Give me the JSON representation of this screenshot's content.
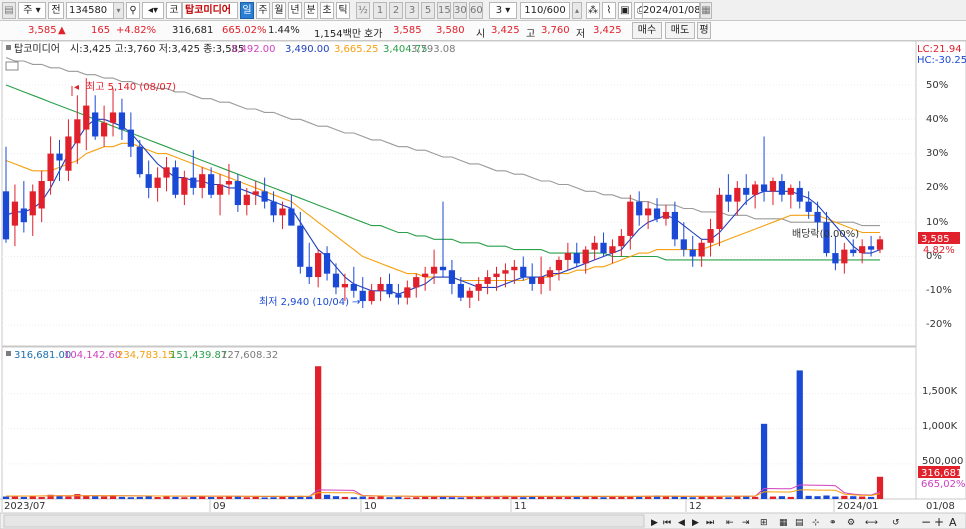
{
  "toolbar": {
    "period_select": "주",
    "prev_button": "전",
    "stock_code": "134580",
    "market_badge": "코",
    "stock_name": "탑코미디어",
    "period_tabs": [
      "일",
      "주",
      "월",
      "년",
      "분",
      "초",
      "틱"
    ],
    "fraction_label": "½",
    "interval_buttons": [
      "1",
      "2",
      "3",
      "5",
      "15",
      "30",
      "60"
    ],
    "interval_value": "3",
    "count_value": "110/600",
    "date_value": "2024/01/08"
  },
  "quote": {
    "price": "3,585",
    "change": "165",
    "change_pct": "+4.82%",
    "volume": "316,681",
    "volume_ratio": "665.02%",
    "turnover_pct": "1.44%",
    "trade_value": "1,154백만",
    "label_ask": "호가",
    "ask_value": "3,585",
    "bid_value": "3,580",
    "label_open": "시",
    "open_value": "3,425",
    "label_high": "고",
    "high_value": "3,760",
    "label_low": "저",
    "low_value": "3,425",
    "buy_button": "매수",
    "sell_button": "매도",
    "misc_button": "평"
  },
  "price_panel": {
    "legend_name": "탑코미디어",
    "legend_ohlc": "시:3,425 고:3,760 저:3,425 종:3,585",
    "ma_values": [
      "3,492.00",
      "3,490.00",
      "3,665.25",
      "3,404.75",
      "3,793.08"
    ],
    "lc_label": "LC:21.94",
    "hc_label": "HC:-30.25",
    "y_ticks": [
      "50%",
      "40%",
      "30%",
      "20%",
      "10%",
      "0%",
      "-10%",
      "-20%"
    ],
    "high_annotation": "최고 5,140 (08/07)",
    "low_annotation": "최저 2,940 (10/04)",
    "ex_div_annotation": "배당락(0.00%)",
    "last_price_tag": "3,585",
    "last_pct_tag": "4.82%"
  },
  "volume_panel": {
    "legend_values": [
      "316,681.00",
      "104,142.60",
      "234,783.15",
      "151,439.87",
      "127,608.32"
    ],
    "y_ticks": [
      "1,500K",
      "1,000K",
      "500,000"
    ],
    "last_volume_tag": "316,681",
    "last_ratio_tag": "665,02%"
  },
  "x_axis": {
    "labels": [
      "2023/07",
      "09",
      "10",
      "11",
      "12",
      "2024/01"
    ],
    "right_label": "01/08"
  },
  "colors": {
    "up": "#e0202b",
    "down": "#1a49d6",
    "ma5": "#1f3fbf",
    "ma20": "#f5a010",
    "ma60": "#29a04a",
    "ma120": "#9a9a9a",
    "vol_ma": "#d040c0"
  },
  "chart_data": {
    "type": "candlestick",
    "title": "탑코미디어",
    "y_range_pct": [
      -24,
      58
    ],
    "series_order": [
      "open",
      "high",
      "low",
      "close"
    ],
    "candles_pct": [
      [
        19,
        32,
        4,
        5
      ],
      [
        9,
        21,
        3,
        16
      ],
      [
        14,
        22,
        7,
        10
      ],
      [
        12,
        21,
        6,
        19
      ],
      [
        14,
        25,
        10,
        22
      ],
      [
        22,
        35,
        18,
        30
      ],
      [
        30,
        34,
        22,
        28
      ],
      [
        25,
        40,
        22,
        35
      ],
      [
        33,
        47,
        27,
        40
      ],
      [
        37,
        52,
        31,
        44
      ],
      [
        42,
        47,
        34,
        35
      ],
      [
        35,
        44,
        32,
        39
      ],
      [
        39,
        49,
        35,
        42
      ],
      [
        42,
        46,
        34,
        37
      ],
      [
        37,
        42,
        29,
        32
      ],
      [
        32,
        34,
        23,
        24
      ],
      [
        24,
        28,
        17,
        20
      ],
      [
        20,
        26,
        16,
        23
      ],
      [
        23,
        29,
        19,
        26
      ],
      [
        26,
        28,
        17,
        18
      ],
      [
        18,
        25,
        15,
        23
      ],
      [
        23,
        31,
        18,
        20
      ],
      [
        20,
        26,
        17,
        24
      ],
      [
        24,
        26,
        17,
        18
      ],
      [
        18,
        24,
        12,
        21
      ],
      [
        21,
        27,
        18,
        22
      ],
      [
        22,
        24,
        13,
        15
      ],
      [
        15,
        20,
        12,
        18
      ],
      [
        18,
        22,
        15,
        19
      ],
      [
        19,
        23,
        14,
        16
      ],
      [
        16,
        19,
        10,
        12
      ],
      [
        12,
        16,
        8,
        14
      ],
      [
        14,
        18,
        10,
        9
      ],
      [
        9,
        13,
        -5,
        -3
      ],
      [
        -3,
        4,
        -8,
        -6
      ],
      [
        -6,
        2,
        -9,
        1
      ],
      [
        1,
        3,
        -7,
        -5
      ],
      [
        -5,
        -2,
        -11,
        -9
      ],
      [
        -9,
        -5,
        -13,
        -8
      ],
      [
        -8,
        -3,
        -12,
        -10
      ],
      [
        -10,
        -6,
        -15,
        -13
      ],
      [
        -13,
        -8,
        -14,
        -10
      ],
      [
        -10,
        -6,
        -13,
        -8
      ],
      [
        -8,
        -5,
        -12,
        -11
      ],
      [
        -11,
        -8,
        -14,
        -12
      ],
      [
        -12,
        -7,
        -14,
        -9
      ],
      [
        -9,
        -5,
        -12,
        -6
      ],
      [
        -6,
        -3,
        -10,
        -5
      ],
      [
        -5,
        2,
        -8,
        -3
      ],
      [
        -3,
        16,
        -6,
        -4
      ],
      [
        -4,
        -1,
        -11,
        -8
      ],
      [
        -8,
        -6,
        -13,
        -12
      ],
      [
        -12,
        -9,
        -15,
        -10
      ],
      [
        -10,
        -6,
        -13,
        -8
      ],
      [
        -8,
        -4,
        -11,
        -6
      ],
      [
        -6,
        -3,
        -10,
        -5
      ],
      [
        -5,
        -2,
        -9,
        -4
      ],
      [
        -4,
        -1,
        -8,
        -3
      ],
      [
        -3,
        0,
        -7,
        -6
      ],
      [
        -6,
        -2,
        -10,
        -8
      ],
      [
        -8,
        0,
        -11,
        -6
      ],
      [
        -6,
        -3,
        -10,
        -4
      ],
      [
        -4,
        0,
        -7,
        -1
      ],
      [
        -1,
        4,
        -4,
        1
      ],
      [
        1,
        4,
        -3,
        -2
      ],
      [
        -2,
        3,
        -5,
        2
      ],
      [
        2,
        6,
        -1,
        4
      ],
      [
        4,
        7,
        0,
        1
      ],
      [
        1,
        5,
        -2,
        3
      ],
      [
        3,
        8,
        0,
        6
      ],
      [
        6,
        18,
        2,
        16
      ],
      [
        16,
        19,
        9,
        12
      ],
      [
        12,
        16,
        8,
        14
      ],
      [
        14,
        17,
        10,
        11
      ],
      [
        11,
        15,
        9,
        13
      ],
      [
        13,
        16,
        3,
        5
      ],
      [
        5,
        10,
        0,
        2
      ],
      [
        2,
        6,
        -3,
        0
      ],
      [
        0,
        5,
        -3,
        4
      ],
      [
        4,
        11,
        0,
        8
      ],
      [
        8,
        20,
        3,
        18
      ],
      [
        18,
        24,
        13,
        16
      ],
      [
        16,
        22,
        12,
        20
      ],
      [
        20,
        24,
        15,
        18
      ],
      [
        18,
        22,
        14,
        21
      ],
      [
        21,
        35,
        16,
        19
      ],
      [
        19,
        23,
        15,
        22
      ],
      [
        22,
        24,
        16,
        18
      ],
      [
        18,
        21,
        14,
        20
      ],
      [
        20,
        22,
        14,
        16
      ],
      [
        16,
        19,
        11,
        13
      ],
      [
        13,
        16,
        8,
        10
      ],
      [
        10,
        13,
        0,
        1
      ],
      [
        1,
        6,
        -4,
        -2
      ],
      [
        -2,
        4,
        -5,
        2
      ],
      [
        2,
        5,
        0,
        1
      ],
      [
        1,
        5,
        -2,
        3
      ],
      [
        3,
        6,
        0,
        2
      ],
      [
        2,
        6,
        1,
        5
      ]
    ],
    "ma5_pct": [
      12,
      13,
      13,
      14,
      16,
      20,
      25,
      30,
      34,
      38,
      40,
      40,
      39,
      38,
      36,
      33,
      30,
      27,
      25,
      23,
      23,
      22,
      22,
      21,
      21,
      20,
      20,
      19,
      18,
      17,
      16,
      15,
      14,
      10,
      6,
      2,
      0,
      -3,
      -6,
      -8,
      -9,
      -10,
      -10,
      -10,
      -11,
      -10,
      -9,
      -8,
      -6,
      -6,
      -6,
      -7,
      -8,
      -9,
      -9,
      -9,
      -8,
      -7,
      -6,
      -6,
      -6,
      -5,
      -5,
      -4,
      -3,
      -2,
      -1,
      0,
      1,
      2,
      5,
      8,
      10,
      11,
      12,
      11,
      9,
      7,
      5,
      5,
      7,
      10,
      13,
      16,
      18,
      19,
      19,
      19,
      19,
      18,
      17,
      15,
      12,
      9,
      6,
      3,
      1,
      1,
      2
    ],
    "ma20_pct": [
      28,
      27,
      26,
      25,
      25,
      25,
      26,
      27,
      28,
      30,
      31,
      32,
      32,
      33,
      33,
      32,
      31,
      30,
      30,
      29,
      28,
      27,
      26,
      25,
      24,
      23,
      22,
      21,
      20,
      19,
      18,
      17,
      16,
      14,
      12,
      10,
      8,
      6,
      4,
      2,
      0,
      -1,
      -2,
      -3,
      -4,
      -5,
      -5,
      -6,
      -6,
      -6,
      -6,
      -7,
      -7,
      -7,
      -7,
      -7,
      -7,
      -7,
      -7,
      -6,
      -6,
      -6,
      -5,
      -5,
      -4,
      -4,
      -3,
      -3,
      -2,
      -1,
      0,
      1,
      1,
      2,
      2,
      2,
      2,
      2,
      2,
      3,
      4,
      5,
      6,
      7,
      8,
      9,
      10,
      11,
      12,
      12,
      12,
      12,
      11,
      10,
      9,
      8,
      7,
      7,
      7
    ],
    "ma60_pct": [
      50,
      49,
      48,
      47,
      46,
      45,
      44,
      43,
      42,
      41,
      40,
      39,
      38,
      37,
      36,
      35,
      34,
      33,
      32,
      31,
      30,
      29,
      28,
      27,
      26,
      25,
      24,
      23,
      22,
      21,
      20,
      19,
      18,
      17,
      16,
      15,
      14,
      13,
      12,
      11,
      10,
      9,
      9,
      8,
      7,
      7,
      6,
      6,
      5,
      5,
      5,
      4,
      4,
      4,
      3,
      3,
      3,
      2,
      2,
      2,
      2,
      1,
      1,
      1,
      1,
      1,
      1,
      1,
      0,
      0,
      0,
      0,
      0,
      0,
      -1,
      -1,
      -1,
      -1,
      -1,
      -1,
      -1,
      -1,
      -1,
      -1,
      -1,
      -1,
      -1,
      -1,
      -1,
      -1,
      -1,
      -1,
      -1,
      -1,
      -1,
      -1,
      -1,
      -1,
      -1
    ],
    "ma120_pct": [
      58,
      57,
      57,
      56,
      56,
      55,
      55,
      54,
      54,
      53,
      53,
      52,
      52,
      51,
      51,
      50,
      50,
      49,
      49,
      48,
      48,
      47,
      46,
      46,
      45,
      45,
      44,
      43,
      43,
      42,
      42,
      41,
      40,
      40,
      39,
      38,
      38,
      37,
      36,
      36,
      35,
      34,
      34,
      33,
      32,
      32,
      31,
      31,
      30,
      29,
      29,
      28,
      27,
      27,
      26,
      25,
      25,
      24,
      24,
      23,
      22,
      22,
      21,
      21,
      20,
      19,
      19,
      18,
      18,
      17,
      17,
      16,
      16,
      15,
      15,
      15,
      14,
      14,
      13,
      13,
      13,
      12,
      12,
      12,
      11,
      11,
      11,
      11,
      10,
      10,
      10,
      10,
      10,
      10,
      10,
      10,
      9,
      9,
      9
    ],
    "volume_k": [
      35,
      45,
      30,
      40,
      28,
      60,
      45,
      35,
      70,
      50,
      40,
      35,
      55,
      30,
      25,
      30,
      40,
      28,
      35,
      30,
      25,
      30,
      40,
      28,
      30,
      35,
      40,
      25,
      30,
      22,
      25,
      30,
      35,
      45,
      35,
      1890,
      60,
      40,
      30,
      25,
      35,
      30,
      40,
      25,
      30,
      20,
      25,
      35,
      40,
      30,
      25,
      20,
      30,
      35,
      40,
      30,
      45,
      30,
      25,
      35,
      30,
      40,
      28,
      30,
      35,
      40,
      30,
      25,
      30,
      35,
      40,
      30,
      45,
      50,
      40,
      35,
      30,
      25,
      40,
      35,
      30,
      25,
      40,
      45,
      30,
      1070,
      35,
      40,
      30,
      1830,
      45,
      40,
      50,
      35,
      45,
      40,
      35,
      30,
      316.681
    ],
    "volume_ma_k": [
      40,
      40,
      42,
      42,
      43,
      45,
      46,
      46,
      47,
      48,
      48,
      47,
      46,
      46,
      45,
      44,
      43,
      42,
      42,
      41,
      40,
      40,
      40,
      39,
      38,
      38,
      38,
      37,
      37,
      36,
      36,
      35,
      35,
      36,
      36,
      130,
      128,
      126,
      125,
      123,
      50,
      45,
      43,
      42,
      40,
      38,
      36,
      35,
      34,
      33,
      33,
      32,
      32,
      32,
      33,
      33,
      34,
      34,
      34,
      35,
      35,
      35,
      34,
      34,
      34,
      35,
      35,
      35,
      35,
      36,
      36,
      37,
      37,
      38,
      38,
      38,
      37,
      37,
      37,
      37,
      37,
      38,
      38,
      38,
      38,
      150,
      148,
      146,
      145,
      200,
      198,
      195,
      193,
      190,
      90,
      70,
      60,
      55,
      104.1426
    ]
  }
}
